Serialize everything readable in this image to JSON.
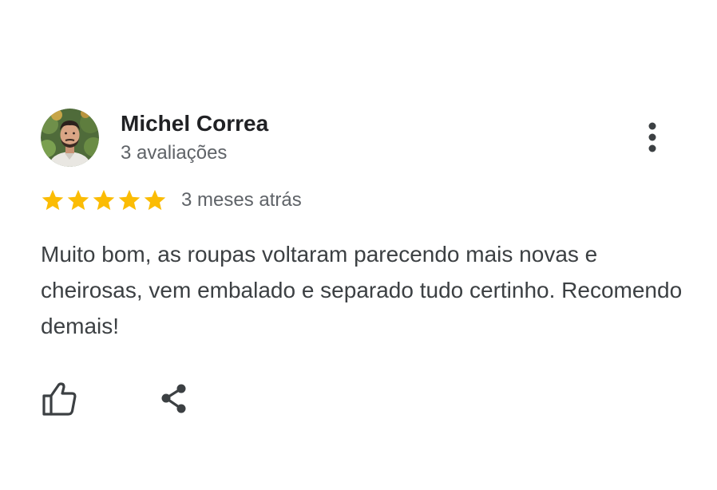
{
  "review": {
    "reviewer_name": "Michel Correa",
    "review_count": "3 avaliações",
    "rating": 5,
    "rating_max": 5,
    "date": "3 meses atrás",
    "text": "Muito bom, as roupas voltaram parecendo mais novas e cheirosas, vem embalado e separado tudo certinho. Recomendo demais!"
  },
  "icons": {
    "more": "more-vert-icon",
    "like": "thumb-up-icon",
    "share": "share-icon",
    "star": "star-icon"
  },
  "colors": {
    "star": "#fbbc04",
    "name": "#202124",
    "secondary_text": "#5f6368",
    "body_text": "#3c4043",
    "icon": "#3c4043"
  }
}
